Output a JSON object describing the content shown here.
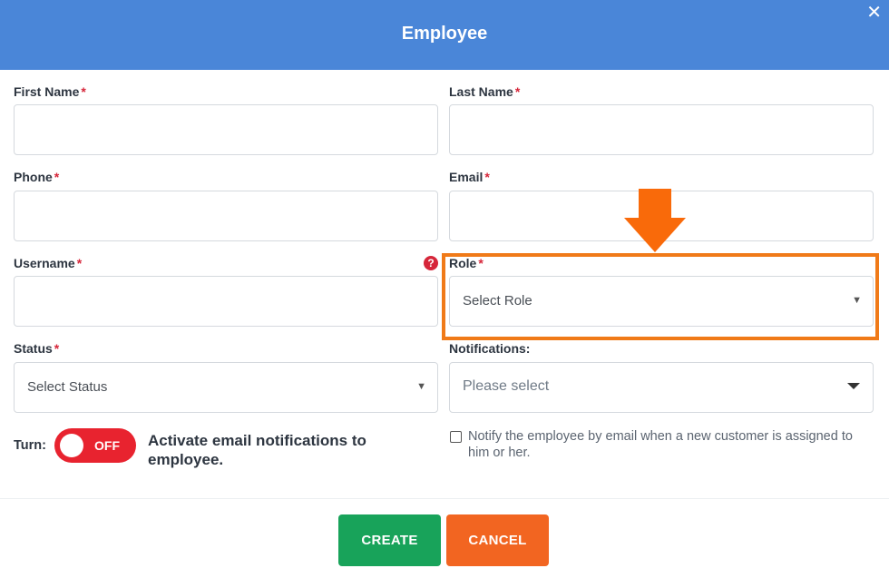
{
  "header": {
    "title": "Employee",
    "close_glyph": "✕",
    "background": "#4a86d8"
  },
  "form": {
    "required_mark": "*",
    "first_name": {
      "label": "First Name",
      "value": ""
    },
    "last_name": {
      "label": "Last Name",
      "value": ""
    },
    "phone": {
      "label": "Phone",
      "value": ""
    },
    "email": {
      "label": "Email",
      "value": ""
    },
    "username": {
      "label": "Username",
      "value": "",
      "help_glyph": "?"
    },
    "role": {
      "label": "Role",
      "selected": "Select Role"
    },
    "status": {
      "label": "Status",
      "selected": "Select Status"
    },
    "notifications": {
      "label": "Notifications:",
      "selected": "Please select"
    },
    "turn": {
      "label": "Turn:",
      "state": "OFF",
      "description": "Activate email notifications to employee."
    },
    "notify_checkbox": {
      "checked": false,
      "text": "Notify the employee by email when a new customer is assigned to him or her."
    }
  },
  "annotation": {
    "highlight_color": "#f07a18",
    "arrow_icon": "arrow-down-icon"
  },
  "footer": {
    "create_label": "CREATE",
    "cancel_label": "CANCEL",
    "create_color": "#18a35a",
    "cancel_color": "#f26521"
  }
}
